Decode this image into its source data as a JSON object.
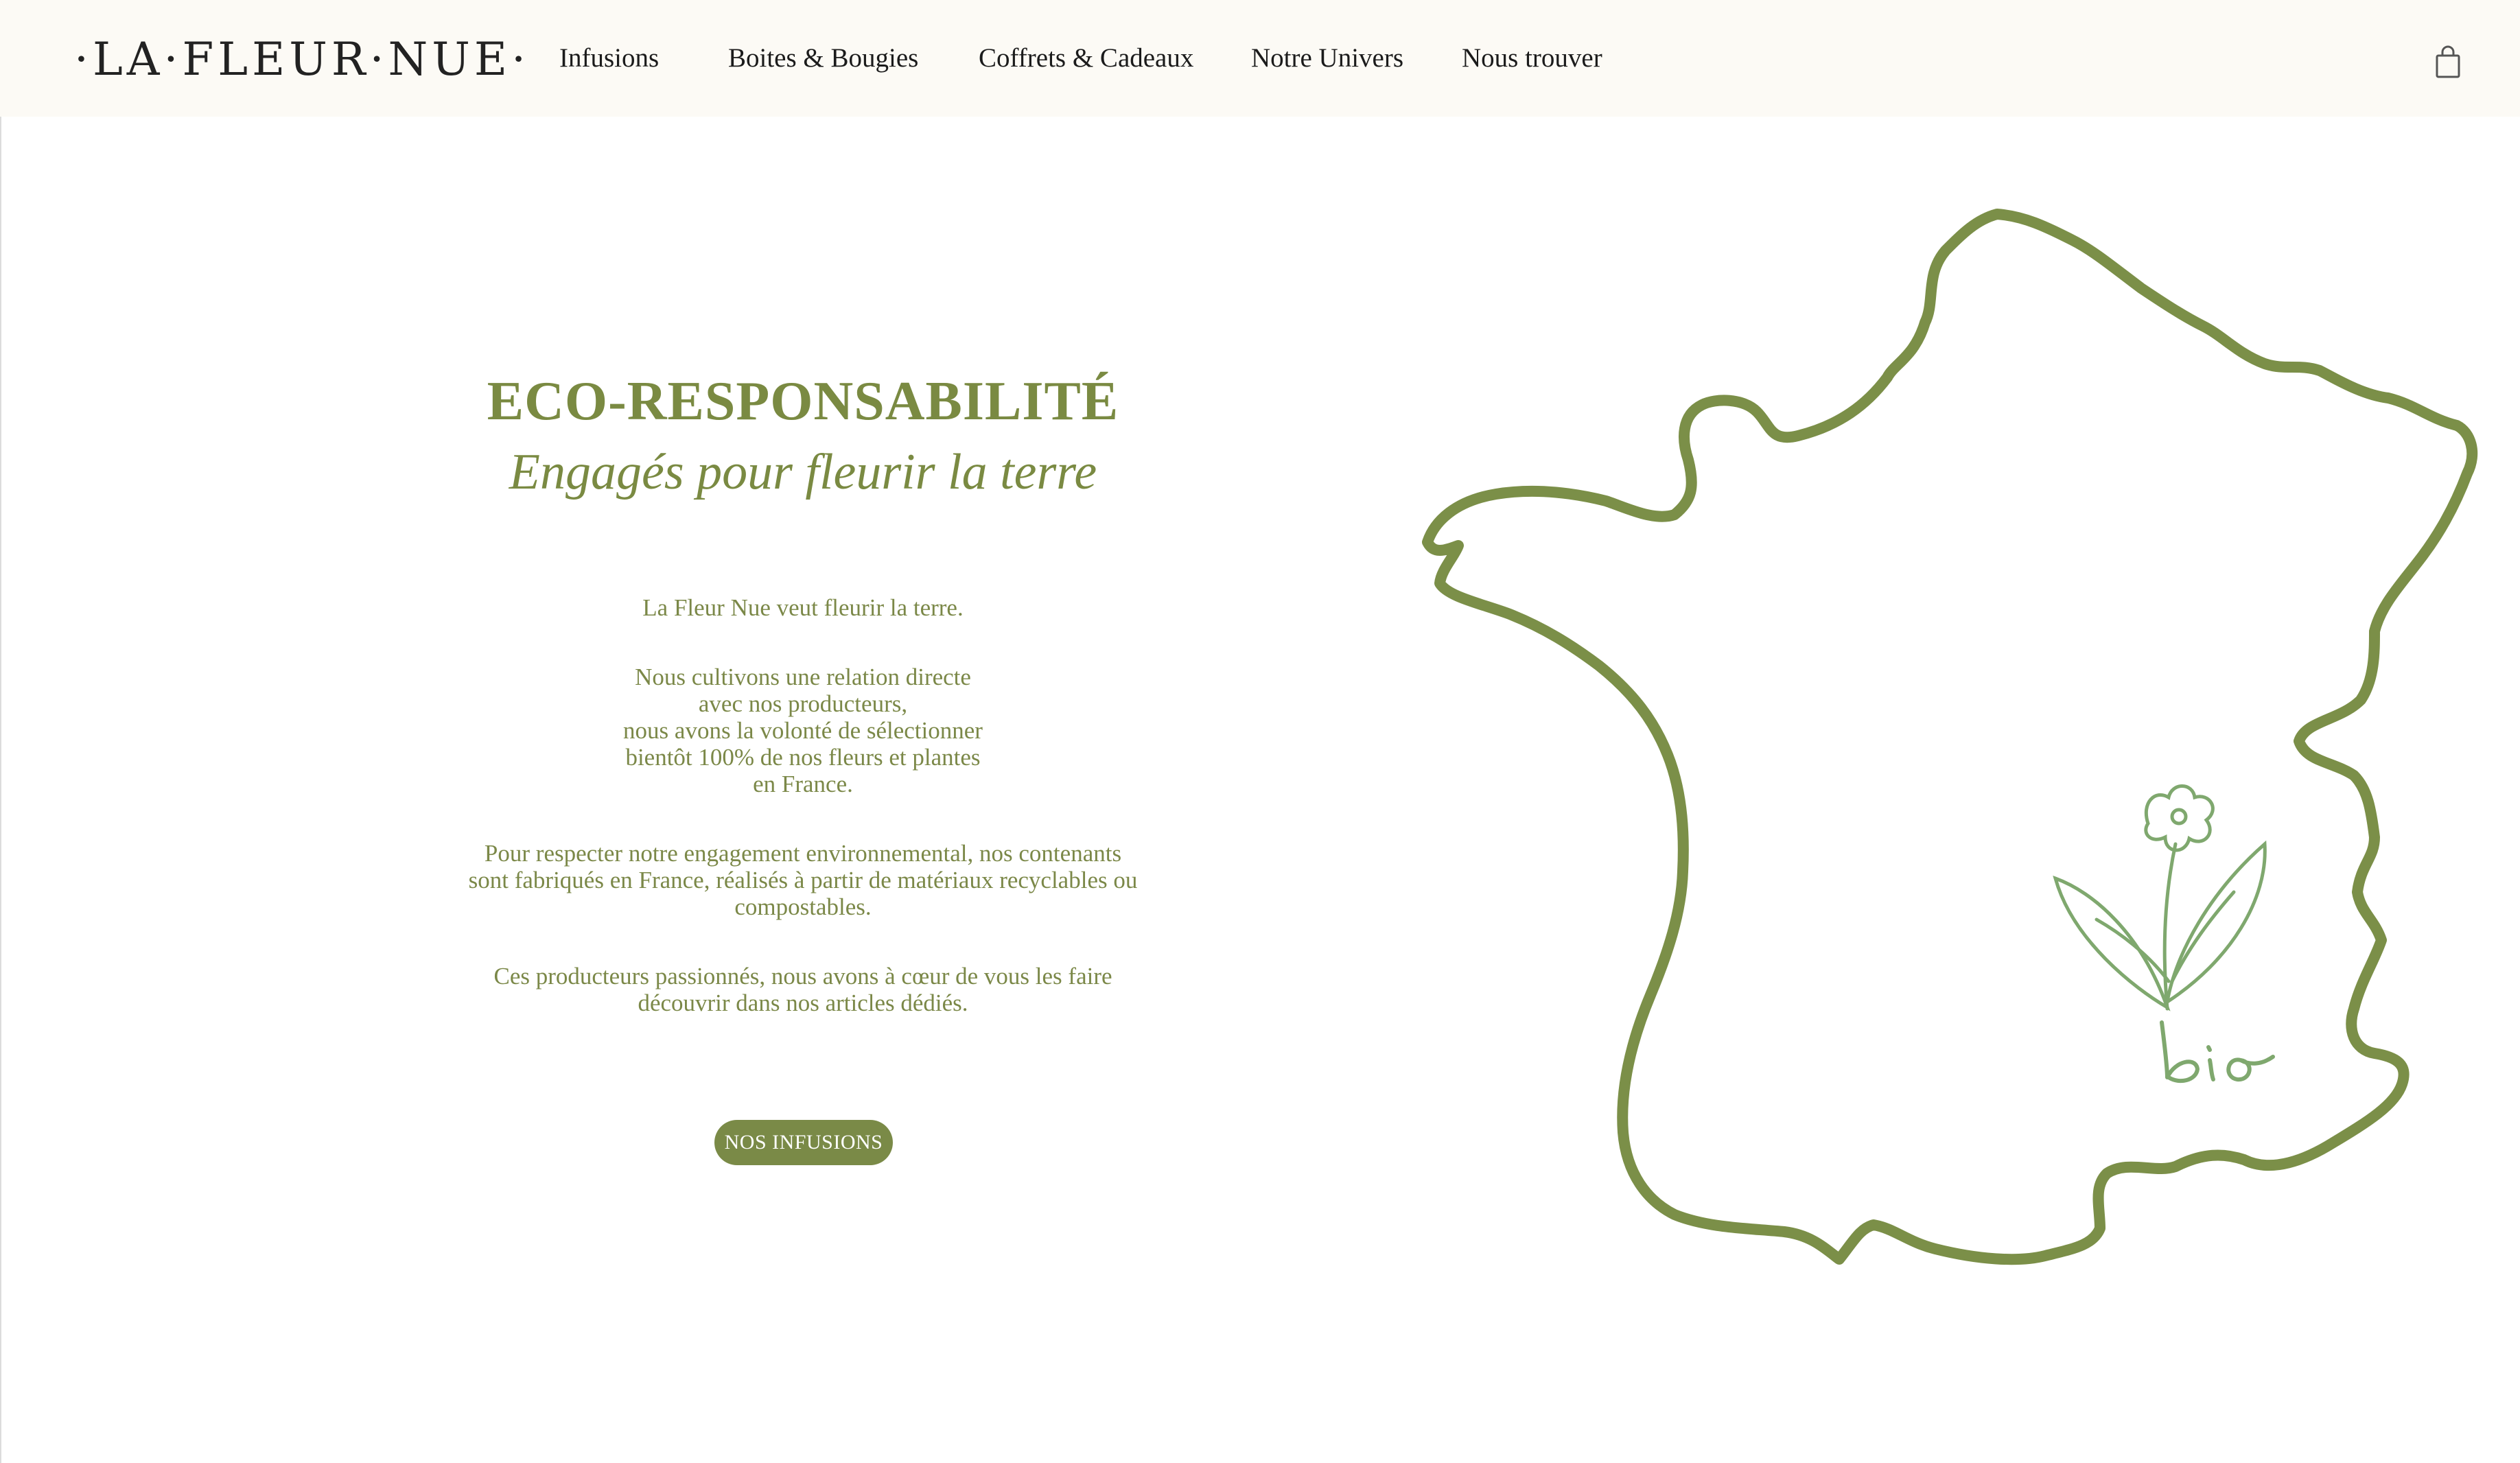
{
  "header": {
    "logo": "·LA·FLEUR·NUE·",
    "nav": [
      {
        "label": "Infusions"
      },
      {
        "label": "Boites & Bougies"
      },
      {
        "label": "Coffrets & Cadeaux"
      },
      {
        "label": "Notre Univers"
      },
      {
        "label": "Nous trouver"
      }
    ],
    "cart_icon": "shopping-bag-icon"
  },
  "main": {
    "title": "ECO-RESPONSABILITÉ",
    "subtitle": "Engagés pour fleurir la terre",
    "paragraphs": [
      "La Fleur Nue veut fleurir la terre.",
      "Nous cultivons une relation directe\navec nos producteurs,\nnous avons la volonté de sélectionner\nbientôt 100% de nos fleurs et plantes\nen France.",
      "Pour respecter notre engagement environnemental, nos contenants\nsont fabriqués en France, réalisés à partir de matériaux recyclables ou\ncompostables.",
      "Ces producteurs passionnés, nous avons à cœur de vous les faire\ndécouvrir dans nos articles dédiés."
    ],
    "cta_label": "NOS INFUSIONS",
    "illustration_label": "bio"
  },
  "colors": {
    "accent": "#7a8a42",
    "header_bg": "#fcfaf5",
    "map_stroke": "#7b8f48",
    "plant_stroke": "#7fa86e"
  }
}
